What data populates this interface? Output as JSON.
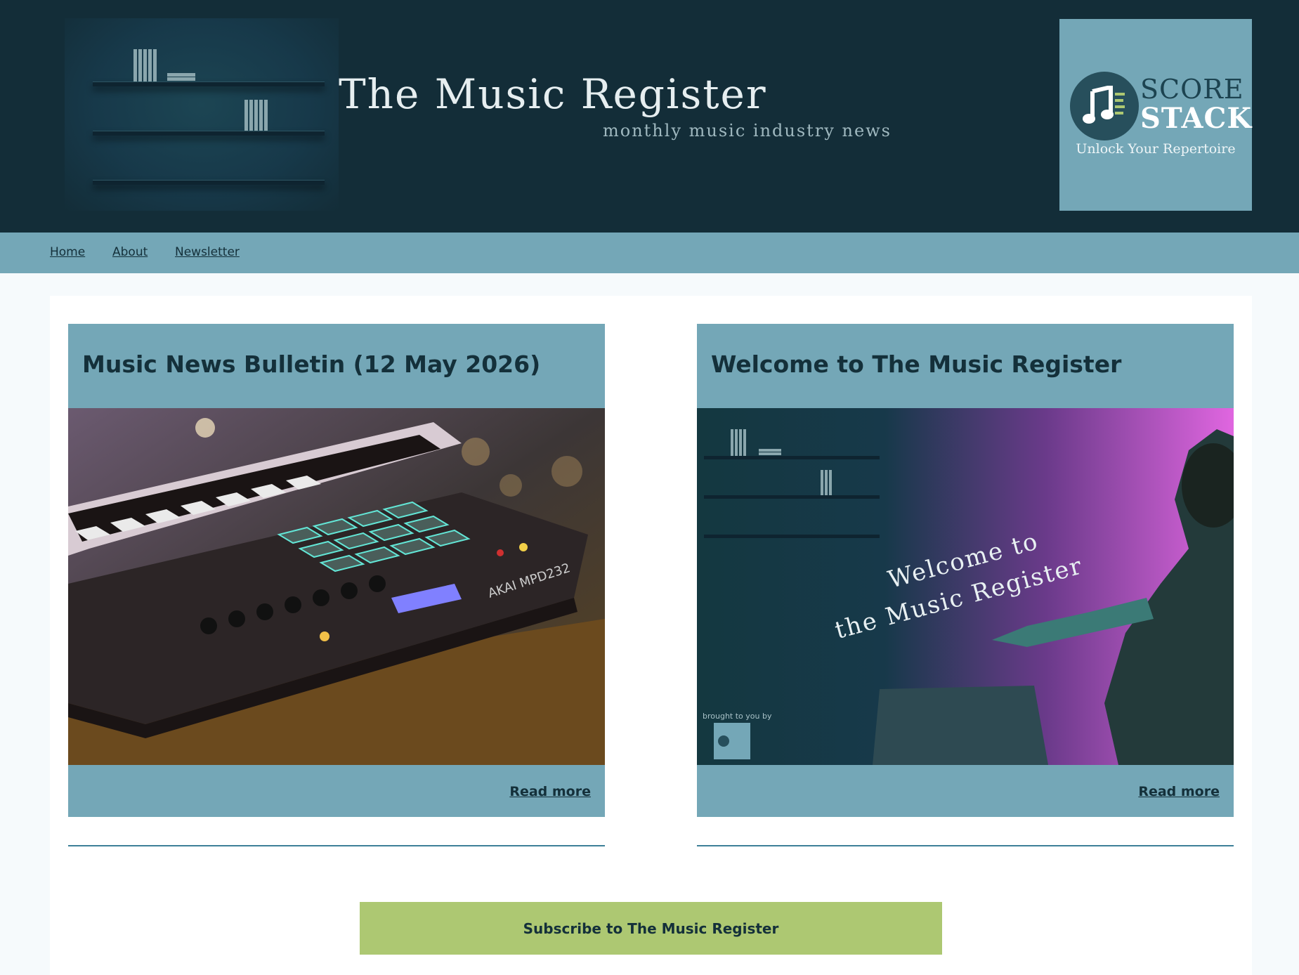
{
  "header": {
    "site_title": "The Music Register",
    "tagline": "monthly music industry news",
    "sponsor_logo": {
      "word_top": "SCORE",
      "word_bottom": "STACK",
      "slogan": "Unlock Your Repertoire"
    }
  },
  "nav": {
    "items": [
      {
        "label": "Home"
      },
      {
        "label": "About"
      },
      {
        "label": "Newsletter"
      }
    ]
  },
  "posts": [
    {
      "title": "Music News Bulletin (12 May 2026)",
      "image_icon": "drum-pad-controller-photo",
      "read_more": "Read more"
    },
    {
      "title": "Welcome to The Music Register",
      "image_icon": "welcome-banner-photo",
      "image_caption_line1": "Welcome to",
      "image_caption_line2": "the Music Register",
      "image_credit": "brought to you by",
      "read_more": "Read more"
    }
  ],
  "subscribe": {
    "label": "Subscribe to The Music Register"
  },
  "colors": {
    "header_bg": "#132d38",
    "accent": "#74a7b7",
    "subscribe_bg": "#adc872",
    "text_dark": "#14303a"
  }
}
